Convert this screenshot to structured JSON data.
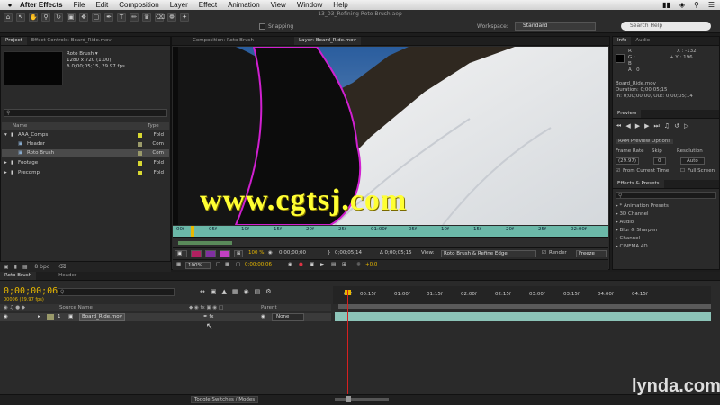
{
  "menubar": {
    "app": "After Effects",
    "items": [
      "File",
      "Edit",
      "Composition",
      "Layer",
      "Effect",
      "Animation",
      "View",
      "Window",
      "Help"
    ]
  },
  "window_title": "13_03_Refining Roto Brush.aep",
  "toolbar": {
    "snapping": "Snapping",
    "workspace_label": "Workspace:",
    "workspace_value": "Standard",
    "search_placeholder": "Search Help"
  },
  "project": {
    "tabs": [
      "Project",
      "Effect Controls: Board_Ride.mov"
    ],
    "item_name": "Roto Brush ▾",
    "item_info1": "1280 x 720 (1.00)",
    "item_info2": "Δ 0;00;05;15, 29.97 fps",
    "col_name": "Name",
    "col_type": "Type",
    "rows": [
      {
        "name": "AAA_Comps",
        "type": "Fold",
        "color": "#d8d832"
      },
      {
        "name": "Header",
        "type": "Com",
        "color": "#9a9a6a"
      },
      {
        "name": "Roto Brush",
        "type": "Com",
        "color": "#9a9a6a"
      },
      {
        "name": "Footage",
        "type": "Fold",
        "color": "#d8d832"
      },
      {
        "name": "Precomp",
        "type": "Fold",
        "color": "#d8d832"
      }
    ],
    "bpc": "8 bpc"
  },
  "viewer": {
    "tabs": [
      "Composition: Roto Brush",
      "Layer: Board_Ride.mov"
    ],
    "watermark": "www.cgtsj.com",
    "ruler": [
      "00f",
      "05f",
      "10f",
      "15f",
      "20f",
      "25f",
      "01:00f",
      "05f",
      "10f",
      "15f",
      "20f",
      "25f",
      "02:00f"
    ],
    "in_time": "0;00;00;00",
    "out_time": "0;00;05;14",
    "dur_time": "Δ 0;00;05;15",
    "view_label": "View:",
    "view_value": "Roto Brush & Refine Edge",
    "render": "Render",
    "freeze": "Freeze",
    "zoom": "100%",
    "zoom_pct": "100 %",
    "exposure": "+0.0"
  },
  "info": {
    "tabs": [
      "Info",
      "Audio"
    ],
    "r": "R :",
    "g": "G :",
    "b": "B :",
    "a": "A : 0",
    "x": "X : -132",
    "y": "+ Y : 196",
    "file": "Board_Ride.mov",
    "duration": "Duration: 0;00;05;15",
    "in_out": "In: 0;00;00;00, Out: 0;00;05;14"
  },
  "preview": {
    "tab": "Preview",
    "ram": "RAM Preview Options",
    "frame_rate": "Frame Rate",
    "skip": "Skip",
    "resolution": "Resolution",
    "fr_value": "(29.97)",
    "skip_value": "0",
    "res_value": "Auto",
    "from_current": "From Current Time",
    "full_screen": "Full Screen"
  },
  "effects": {
    "tab": "Effects & Presets",
    "items": [
      "* Animation Presets",
      "3D Channel",
      "Audio",
      "Blur & Sharpen",
      "Channel",
      "CINEMA 4D"
    ]
  },
  "timeline": {
    "tabs": [
      "Roto Brush",
      "Header"
    ],
    "timecode": "0;00;00;06",
    "timecode_sub": "00006 (29.97 fps)",
    "col_source": "Source Name",
    "col_parent": "Parent",
    "layer_num": "1",
    "layer_name": "Board_Ride.mov",
    "parent_value": "None",
    "ticks": [
      "00f",
      "00:15f",
      "01:00f",
      "01:15f",
      "02:00f",
      "02:15f",
      "03:00f",
      "03:15f",
      "04:00f",
      "04:15f"
    ],
    "toggle": "Toggle Switches / Modes"
  },
  "branding": "lynda.com"
}
